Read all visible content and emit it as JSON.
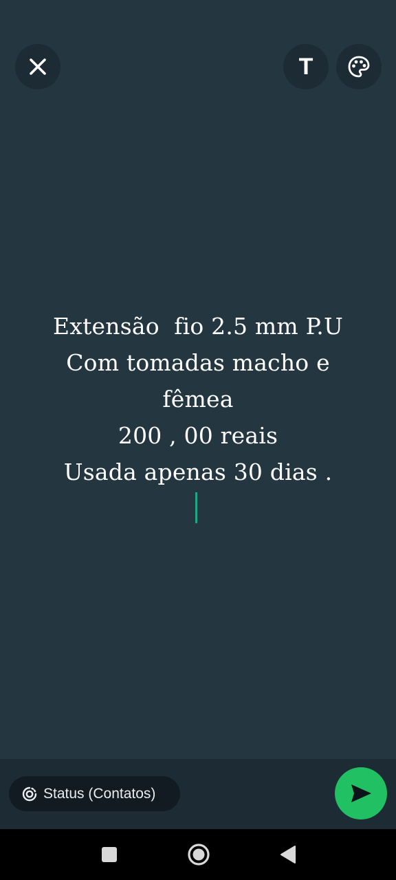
{
  "toolbar": {
    "close_icon": "close-icon",
    "text_tool_glyph": "T",
    "palette_icon": "palette-icon"
  },
  "status_text": {
    "lines": [
      "Extensão  fio 2.5 mm P.U",
      "Com tomadas macho e",
      "fêmea",
      "200 , 00 reais",
      "Usada apenas 30 dias ."
    ]
  },
  "bottom_bar": {
    "audience_label": "Status (Contatos)",
    "audience_icon": "status-ring-icon",
    "send_icon": "send-icon"
  },
  "nav_bar": {
    "recents_icon": "square-icon",
    "home_icon": "circle-icon",
    "back_icon": "triangle-back-icon"
  },
  "colors": {
    "background": "#243640",
    "accent_green": "#21c063",
    "caret": "#1fa885"
  }
}
